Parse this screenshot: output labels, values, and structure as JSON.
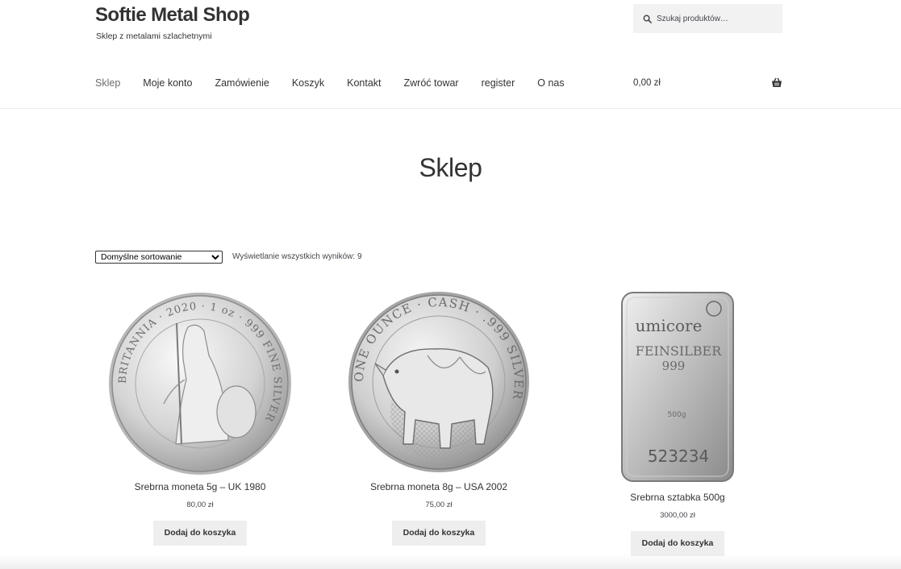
{
  "header": {
    "site_title": "Softie Metal Shop",
    "tagline": "Sklep z metalami szlachetnymi",
    "search_placeholder": "Szukaj produktów…"
  },
  "nav": {
    "items": [
      {
        "label": "Sklep",
        "current": true
      },
      {
        "label": "Moje konto"
      },
      {
        "label": "Zamówienie"
      },
      {
        "label": "Koszyk"
      },
      {
        "label": "Kontakt"
      },
      {
        "label": "Zwróć towar"
      },
      {
        "label": "register"
      },
      {
        "label": "O nas"
      }
    ]
  },
  "cart": {
    "total": "0,00 zł",
    "icon": "basket-icon"
  },
  "page": {
    "title": "Sklep"
  },
  "shop": {
    "sort_selected": "Domyślne sortowanie",
    "result_count": "Wyświetlanie wszystkich wyników: 9"
  },
  "products": [
    {
      "name": "Srebrna moneta 5g – UK 1980",
      "price": "80,00 zł",
      "button": "Dodaj do koszyka",
      "image": "britannia-coin"
    },
    {
      "name": "Srebrna moneta 8g – USA 2002",
      "price": "75,00 zł",
      "button": "Dodaj do koszyka",
      "image": "rhino-coin"
    },
    {
      "name": "Srebrna sztabka 500g",
      "price": "3000,00 zł",
      "button": "Dodaj do koszyka",
      "image": "umicore-bar"
    }
  ],
  "image_text": {
    "coin1_ring": "BRITANNIA · 2020 · 1 oz · 999 FINE SILVER",
    "coin2_ring": "ONE OUNCE · CASH · .999 SILVER",
    "bar_brand": "umicore",
    "bar_line1": "FEINSILBER",
    "bar_line2": "999",
    "bar_weight": "500g",
    "bar_serial": "523234"
  },
  "colors": {
    "text": "#333333",
    "muted": "#6d6d6d",
    "search_bg": "#f2f2f2",
    "button_bg": "#eeeeee"
  }
}
